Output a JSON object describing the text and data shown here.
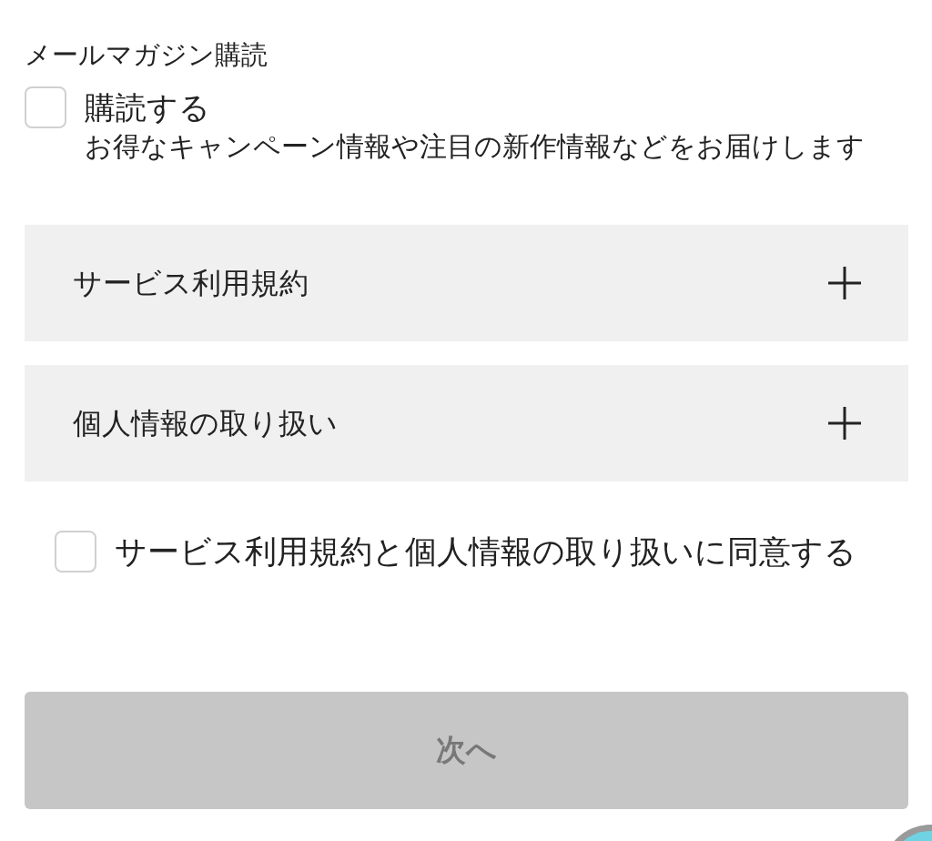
{
  "newsletter": {
    "heading": "メールマガジン購読",
    "subscribe": {
      "label": "購読する",
      "checked": false
    },
    "description": "お得なキャンペーン情報や注目の新作情報などをお届けします"
  },
  "accordions": [
    {
      "title": "サービス利用規約",
      "expanded": false
    },
    {
      "title": "個人情報の取り扱い",
      "expanded": false
    }
  ],
  "agreement": {
    "label": "サービス利用規約と個人情報の取り扱いに同意する",
    "checked": false
  },
  "next_button": {
    "label": "次へ",
    "disabled": true
  }
}
